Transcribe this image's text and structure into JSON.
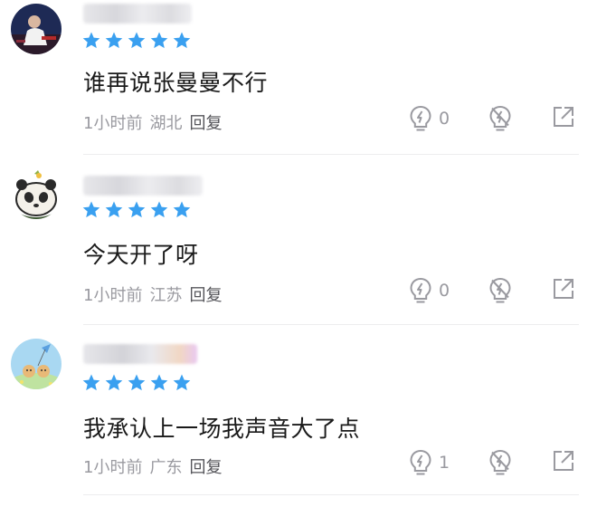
{
  "colors": {
    "star": "#3aa0f0",
    "text": "#1a1a1a",
    "meta": "#9a9aa0",
    "reply": "#55555a",
    "icon": "#9a9aa0"
  },
  "comments": [
    {
      "avatar_icon": "photo-avatar-icon",
      "rating": 5,
      "text": "谁再说张曼曼不行",
      "time": "1小时前",
      "location": "湖北",
      "reply_label": "回复",
      "likes": "0"
    },
    {
      "avatar_icon": "panda-avatar-icon",
      "rating": 5,
      "text": "今天开了呀",
      "time": "1小时前",
      "location": "江苏",
      "reply_label": "回复",
      "likes": "0"
    },
    {
      "avatar_icon": "cartoon-avatar-icon",
      "rating": 5,
      "text": "我承认上一场我声音大了点",
      "time": "1小时前",
      "location": "广东",
      "reply_label": "回复",
      "likes": "1"
    }
  ]
}
